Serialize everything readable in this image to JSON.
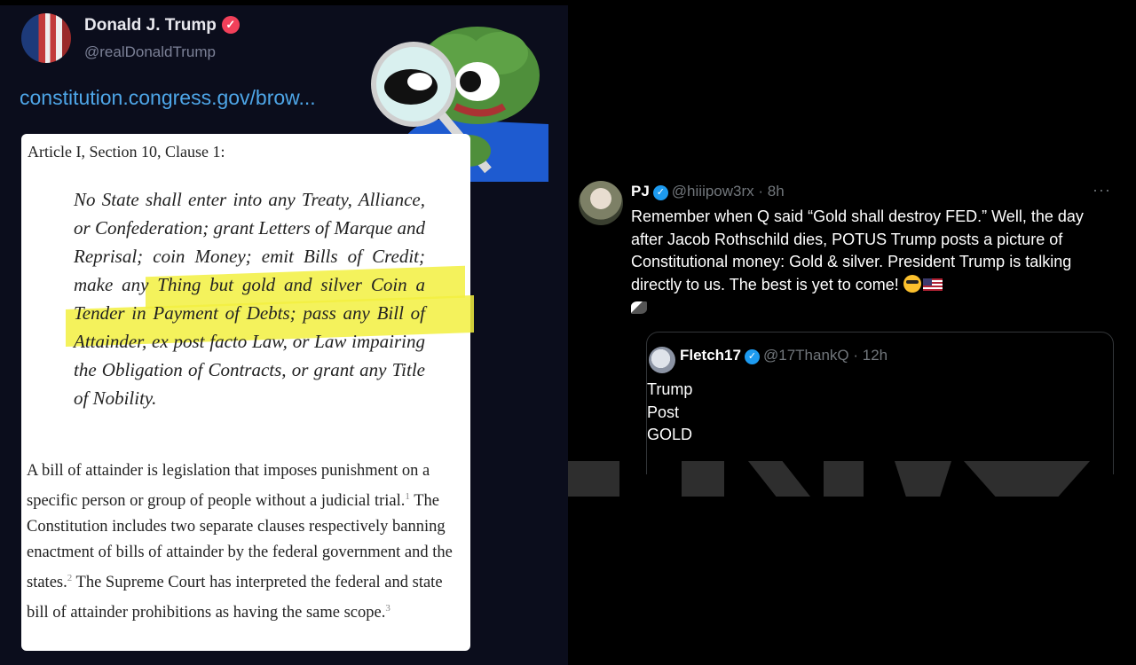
{
  "left_post": {
    "name": "Donald J. Trump",
    "verified": "✓",
    "handle": "@realDonaldTrump",
    "link_text": "constitution.congress.gov/brow...",
    "document": {
      "heading": "Article I, Section 10, Clause 1:",
      "clause_text": "No State shall enter into any Treaty, Alliance, or Confederation; grant Letters of Marque and Reprisal; coin Money; emit Bills of Credit; make any Thing but gold and silver Coin a Tender in Payment of Debts; pass any Bill of Attainder, ex post facto Law, or Law impairing the Obligation of Contracts, or grant any Title of Nobility.",
      "paragraph_parts": [
        "A bill of attainder is legislation that imposes punishment on a specific person or group of people without a judicial trial.",
        "1",
        " The Constitution includes two separate clauses respectively banning enactment of bills of attainder by the federal government and the states.",
        "2",
        " The Supreme Court has interpreted the federal and state bill of attainder prohibitions as having the same scope.",
        "3"
      ]
    }
  },
  "right_post": {
    "name": "PJ",
    "handle": "@hiiipow3rx",
    "separator": "·",
    "time": "8h",
    "more": "···",
    "text": "Remember when Q said “Gold shall destroy FED.” Well, the day after Jacob Rothschild dies, POTUS Trump posts a picture of Constitutional money: Gold & silver. President Trump is talking directly to us. The best is yet to come!",
    "emoji_icons": [
      "sunglasses-emoji-icon",
      "us-flag-icon",
      "eagle-icon"
    ],
    "quoted": {
      "name": "Fletch17",
      "handle": "@17ThankQ",
      "time": "12h",
      "lines": [
        "Trump",
        "Post",
        "GOLD"
      ]
    }
  },
  "colors": {
    "link_blue": "#4ea6e8",
    "highlight_yellow": "#f2f040",
    "verified_blue": "#1d9bf0"
  }
}
